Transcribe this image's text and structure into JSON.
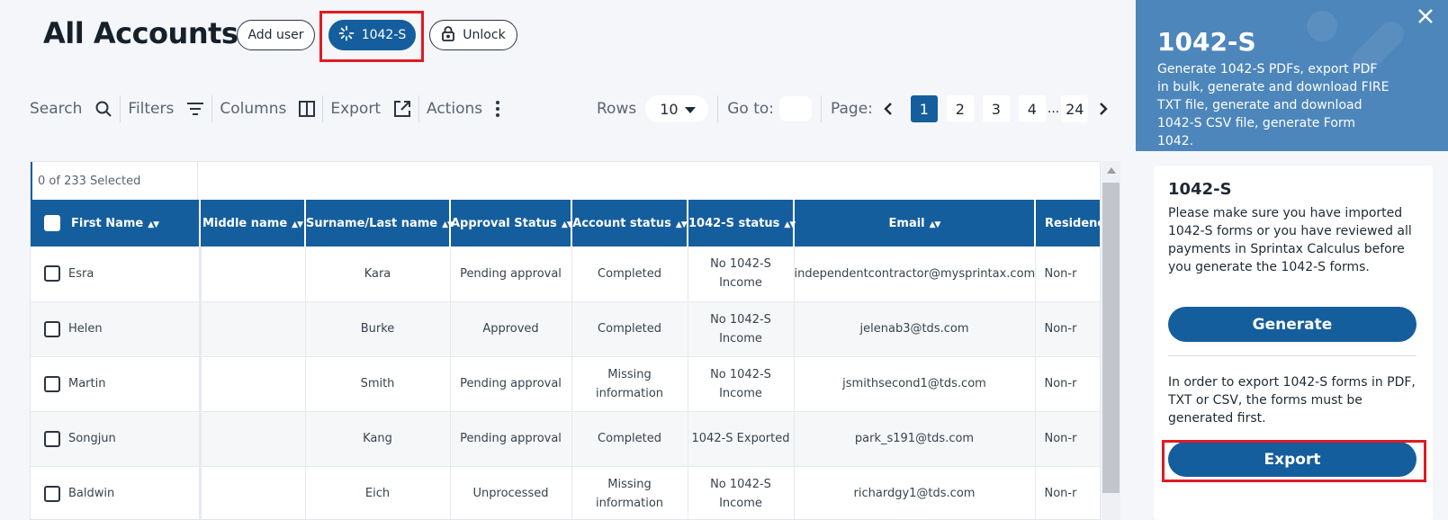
{
  "header": {
    "title": "All Accounts",
    "add_user_label": "Add user",
    "form_label": "1042-S",
    "unlock_label": "Unlock"
  },
  "toolbar": {
    "search_label": "Search",
    "filters_label": "Filters",
    "columns_label": "Columns",
    "export_label": "Export",
    "actions_label": "Actions"
  },
  "pager": {
    "rows_label": "Rows",
    "rows_value": "10",
    "goto_label": "Go to:",
    "page_label": "Page:",
    "pages": [
      "1",
      "2",
      "3",
      "4",
      "24"
    ],
    "current_page": "1",
    "ellipsis": "..."
  },
  "table": {
    "selected_text": "0 of 233 Selected",
    "columns": [
      "First Name",
      "Middle name",
      "Surname/Last name",
      "Approval Status",
      "Account status",
      "1042-S status",
      "Email",
      "Residency"
    ],
    "rows": [
      {
        "first": "Esra",
        "middle": "",
        "last": "Kara",
        "approval": "Pending approval",
        "account": "Completed",
        "status1042": "No 1042-S Income",
        "email": "independentcontractor@mysprintax.com",
        "residency": "Non-r"
      },
      {
        "first": "Helen",
        "middle": "",
        "last": "Burke",
        "approval": "Approved",
        "account": "Completed",
        "status1042": "No 1042-S Income",
        "email": "jelenab3@tds.com",
        "residency": "Non-r"
      },
      {
        "first": "Martin",
        "middle": "",
        "last": "Smith",
        "approval": "Pending approval",
        "account": "Missing information",
        "status1042": "No 1042-S Income",
        "email": "jsmithsecond1@tds.com",
        "residency": "Non-r"
      },
      {
        "first": "Songjun",
        "middle": "",
        "last": "Kang",
        "approval": "Pending approval",
        "account": "Completed",
        "status1042": "1042-S Exported",
        "email": "park_s191@tds.com",
        "residency": "Non-r"
      },
      {
        "first": "Baldwin",
        "middle": "",
        "last": "Eich",
        "approval": "Unprocessed",
        "account": "Missing information",
        "status1042": "No 1042-S Income",
        "email": "richardgy1@tds.com",
        "residency": "Non-r"
      }
    ]
  },
  "side_panel": {
    "title": "1042-S",
    "description": "Generate 1042-S PDFs, export PDF in bulk, generate and download FIRE TXT file, generate and download 1042-S CSV file, generate Form 1042.",
    "card_title": "1042-S",
    "card_text": "Please make sure you have imported 1042-S forms or you have reviewed all payments in Sprintax Calculus before you generate the 1042-S forms.",
    "generate_label": "Generate",
    "export_note": "In order to export 1042-S forms in PDF, TXT or CSV, the forms must be generated first.",
    "export_label": "Export"
  },
  "colors": {
    "primary": "#155e9e",
    "panel_header": "#4d86bb",
    "highlight": "#e01b22",
    "background": "#f4f6f9"
  }
}
